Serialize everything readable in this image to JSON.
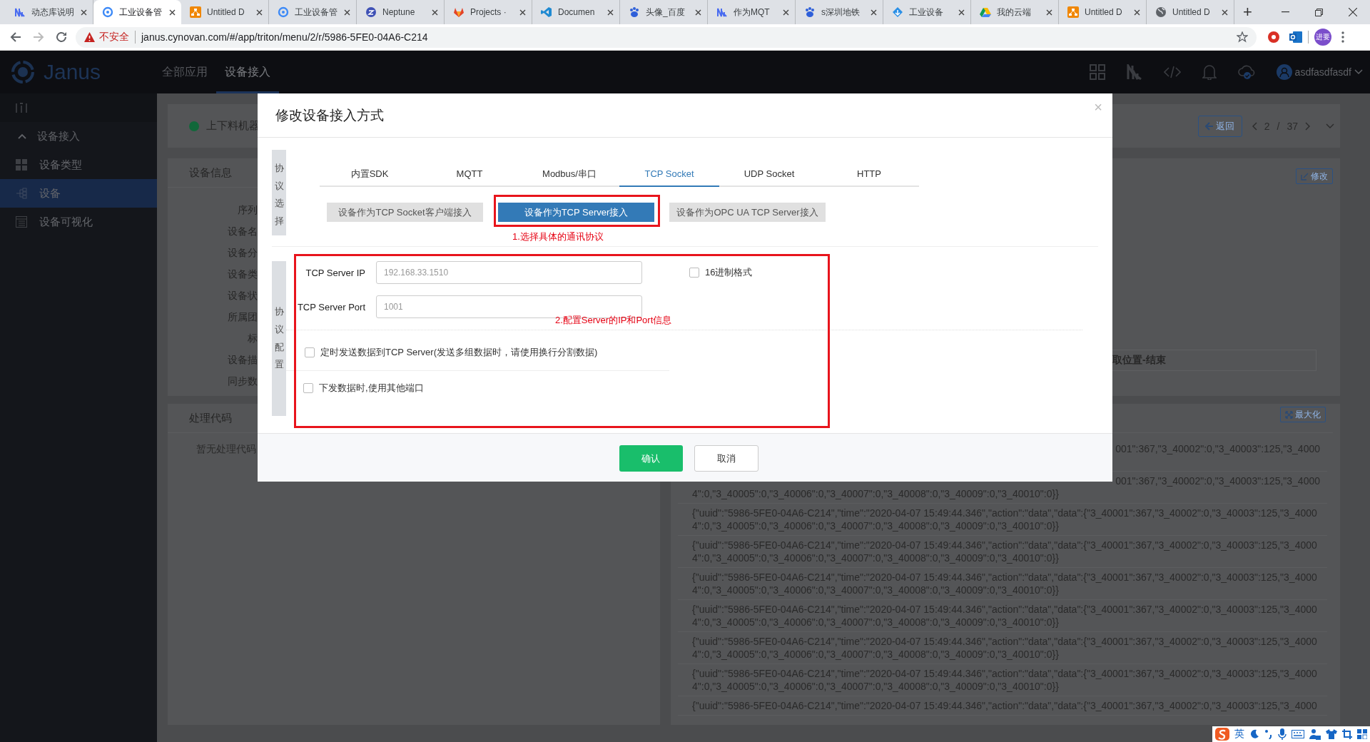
{
  "browser": {
    "tabs": [
      {
        "title": "动态库说明",
        "kind": "stripes",
        "selected": false
      },
      {
        "title": "工业设备管",
        "kind": "ring",
        "selected": true
      },
      {
        "title": "Untitled D",
        "kind": "diagram",
        "selected": false
      },
      {
        "title": "工业设备管",
        "kind": "ring",
        "selected": false
      },
      {
        "title": "Neptune",
        "kind": "disc",
        "selected": false
      },
      {
        "title": "Projects ·",
        "kind": "fox",
        "selected": false
      },
      {
        "title": "Documen",
        "kind": "ribbon",
        "selected": false
      },
      {
        "title": "头像_百度",
        "kind": "paw",
        "selected": false
      },
      {
        "title": "作为MQT",
        "kind": "stripes",
        "selected": false
      },
      {
        "title": "s深圳地铁",
        "kind": "paw",
        "selected": false
      },
      {
        "title": "工业设备",
        "kind": "kite",
        "selected": false
      },
      {
        "title": "我的云端",
        "kind": "triangle",
        "selected": false
      },
      {
        "title": "Untitled D",
        "kind": "diagram",
        "selected": false
      },
      {
        "title": "Untitled D",
        "kind": "globe",
        "selected": false
      }
    ],
    "new_tab": "+",
    "warning": "不安全",
    "url": "janus.cynovan.com/#/app/triton/menu/2/r/5986-5FE0-04A6-C214",
    "profile": "进要"
  },
  "header": {
    "logo": "Janus",
    "nav": [
      {
        "label": "全部应用",
        "selected": false
      },
      {
        "label": "设备接入",
        "selected": true
      }
    ],
    "user": "asdfasdfasdf"
  },
  "sidebar": {
    "group": "设备接入",
    "expanded": true,
    "items": [
      {
        "label": "设备类型",
        "kind": "grid",
        "selected": false
      },
      {
        "label": "设备",
        "kind": "tree",
        "selected": true
      },
      {
        "label": "设备可视化",
        "kind": "doc",
        "selected": false
      }
    ]
  },
  "device_bar": {
    "name": "上下料机器",
    "back": "返回",
    "page": "2",
    "separator": "/",
    "total": "37"
  },
  "info_card": {
    "title": "设备信息",
    "labels": [
      "序列",
      "设备名",
      "设备分",
      "设备类",
      "设备状",
      "所属团",
      "标",
      "设备描",
      "同步数"
    ],
    "edit": "修改",
    "field": "取位置-结束"
  },
  "code_card": {
    "title": "处理代码",
    "empty": "暂无处理代码"
  },
  "log_card": {
    "maximize": "最大化",
    "entries": [
      {
        "kind": "clipped",
        "text": "001\":367,\"3_40002\":0,\"3_40003\":125,\"3_4000"
      },
      {
        "kind": "clipped",
        "text": "001\":367,\"3_40002\":0,\"3_40003\":125,\"3_4000",
        "tail": "4\":0,\"3_40005\":0,\"3_40006\":0,\"3_40007\":0,\"3_40008\":0,\"3_40009\":0,\"3_40010\":0}}"
      },
      {
        "kind": "full",
        "text": "{\"uuid\":\"5986-5FE0-04A6-C214\",\"time\":\"2020-04-07 15:49:44.346\",\"action\":\"data\",\"data\":{\"3_40001\":367,\"3_40002\":0,\"3_40003\":125,\"3_40004\":0,\"3_40005\":0,\"3_40006\":0,\"3_40007\":0,\"3_40008\":0,\"3_40009\":0,\"3_40010\":0}}"
      },
      {
        "kind": "full",
        "text": "{\"uuid\":\"5986-5FE0-04A6-C214\",\"time\":\"2020-04-07 15:49:44.346\",\"action\":\"data\",\"data\":{\"3_40001\":367,\"3_40002\":0,\"3_40003\":125,\"3_40004\":0,\"3_40005\":0,\"3_40006\":0,\"3_40007\":0,\"3_40008\":0,\"3_40009\":0,\"3_40010\":0}}"
      },
      {
        "kind": "full",
        "text": "{\"uuid\":\"5986-5FE0-04A6-C214\",\"time\":\"2020-04-07 15:49:44.346\",\"action\":\"data\",\"data\":{\"3_40001\":367,\"3_40002\":0,\"3_40003\":125,\"3_40004\":0,\"3_40005\":0,\"3_40006\":0,\"3_40007\":0,\"3_40008\":0,\"3_40009\":0,\"3_40010\":0}}"
      },
      {
        "kind": "full",
        "text": "{\"uuid\":\"5986-5FE0-04A6-C214\",\"time\":\"2020-04-07 15:49:44.346\",\"action\":\"data\",\"data\":{\"3_40001\":367,\"3_40002\":0,\"3_40003\":125,\"3_40004\":0,\"3_40005\":0,\"3_40006\":0,\"3_40007\":0,\"3_40008\":0,\"3_40009\":0,\"3_40010\":0}}"
      },
      {
        "kind": "full",
        "text": "{\"uuid\":\"5986-5FE0-04A6-C214\",\"time\":\"2020-04-07 15:49:44.346\",\"action\":\"data\",\"data\":{\"3_40001\":367,\"3_40002\":0,\"3_40003\":125,\"3_40004\":0,\"3_40005\":0,\"3_40006\":0,\"3_40007\":0,\"3_40008\":0,\"3_40009\":0,\"3_40010\":0}}"
      },
      {
        "kind": "full",
        "text": "{\"uuid\":\"5986-5FE0-04A6-C214\",\"time\":\"2020-04-07 15:49:44.346\",\"action\":\"data\",\"data\":{\"3_40001\":367,\"3_40002\":0,\"3_40003\":125,\"3_40004\":0,\"3_40005\":0,\"3_40006\":0,\"3_40007\":0,\"3_40008\":0,\"3_40009\":0,\"3_40010\":0}}"
      },
      {
        "kind": "cut",
        "text": "{\"uuid\":\"5986-5FE0-04A6-C214\",\"time\":\"2020-04-07 15:49:44.346\",\"action\":\"data\",\"data\":{\"3_40001\":367,\"3_40002\":0,\"3_40003\":125,\"3_4000"
      }
    ]
  },
  "modal": {
    "title": "修改设备接入方式",
    "close": "×",
    "protocol_label": "协议选择",
    "tabs": [
      {
        "label": "内置SDK",
        "selected": false
      },
      {
        "label": "MQTT",
        "selected": false
      },
      {
        "label": "Modbus/串口",
        "selected": false
      },
      {
        "label": "TCP Socket",
        "selected": true
      },
      {
        "label": "UDP Socket",
        "selected": false
      },
      {
        "label": "HTTP",
        "selected": false
      }
    ],
    "modes": [
      {
        "label": "设备作为TCP Socket客户端接入",
        "selected": false
      },
      {
        "label": "设备作为TCP Server接入",
        "selected": true
      },
      {
        "label": "设备作为OPC UA TCP Server接入",
        "selected": false
      }
    ],
    "note_1": "1.选择具体的通讯协议",
    "config_label": "协议配置",
    "fields": [
      {
        "label": "TCP Server IP",
        "value": "192.168.33.1510"
      },
      {
        "label": "TCP Server Port",
        "value": "1001"
      }
    ],
    "hex": {
      "label": "16进制格式",
      "checked": false
    },
    "note_2": "2.配置Server的IP和Port信息",
    "options": [
      {
        "label": "定时发送数据到TCP Server(发送多组数据时，请使用换行分割数据)",
        "checked": false
      },
      {
        "label": "下发数据时,使用其他端口",
        "checked": false
      }
    ],
    "buttons": [
      {
        "label": "确认",
        "kind": "primary"
      },
      {
        "label": "取消",
        "kind": "default"
      }
    ]
  },
  "ime": {
    "mode": "英"
  }
}
